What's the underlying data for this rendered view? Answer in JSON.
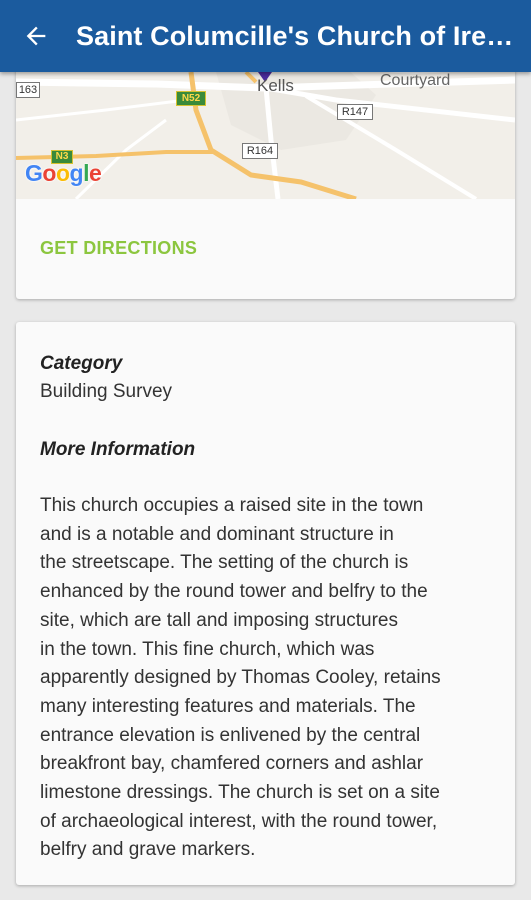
{
  "appbar": {
    "title": "Saint Columcille's Church of Ireland",
    "back_icon": "arrow-back-icon"
  },
  "map": {
    "labels": {
      "r163": "163",
      "n52": "N52",
      "kells": "Kells",
      "courtyard": "Courtyard",
      "r147": "R147",
      "r164": "R164",
      "n3": "N3"
    },
    "google_logo": "Google",
    "colors": {
      "land": "#f2efe9",
      "road_major": "#f5c26b",
      "road_minor": "#ffffff",
      "shield_green": "#3a8a3a",
      "marker": "#4b2d9c"
    }
  },
  "actions": {
    "get_directions": "GET DIRECTIONS"
  },
  "info": {
    "category_label": "Category",
    "category_value": "Building Survey",
    "more_info_label": "More Information",
    "description_lines": [
      "This church occupies a raised site in the town",
      "and is a notable and dominant structure in",
      "the streetscape. The setting of the church is",
      "enhanced by the round tower and belfry to the",
      "site, which are tall and imposing structures",
      "in the town. This fine church, which was",
      "apparently designed by Thomas Cooley, retains",
      "many interesting features and materials. The",
      "entrance elevation is enlivened by the central",
      "breakfront bay, chamfered corners and ashlar",
      "limestone dressings. The church is set on a site",
      "of archaeological interest, with the round tower,",
      "belfry and grave markers."
    ]
  },
  "colors": {
    "appbar": "#1b5b9e",
    "accent": "#8cc63f",
    "card": "#fafafa",
    "background": "#e9e9e9"
  }
}
